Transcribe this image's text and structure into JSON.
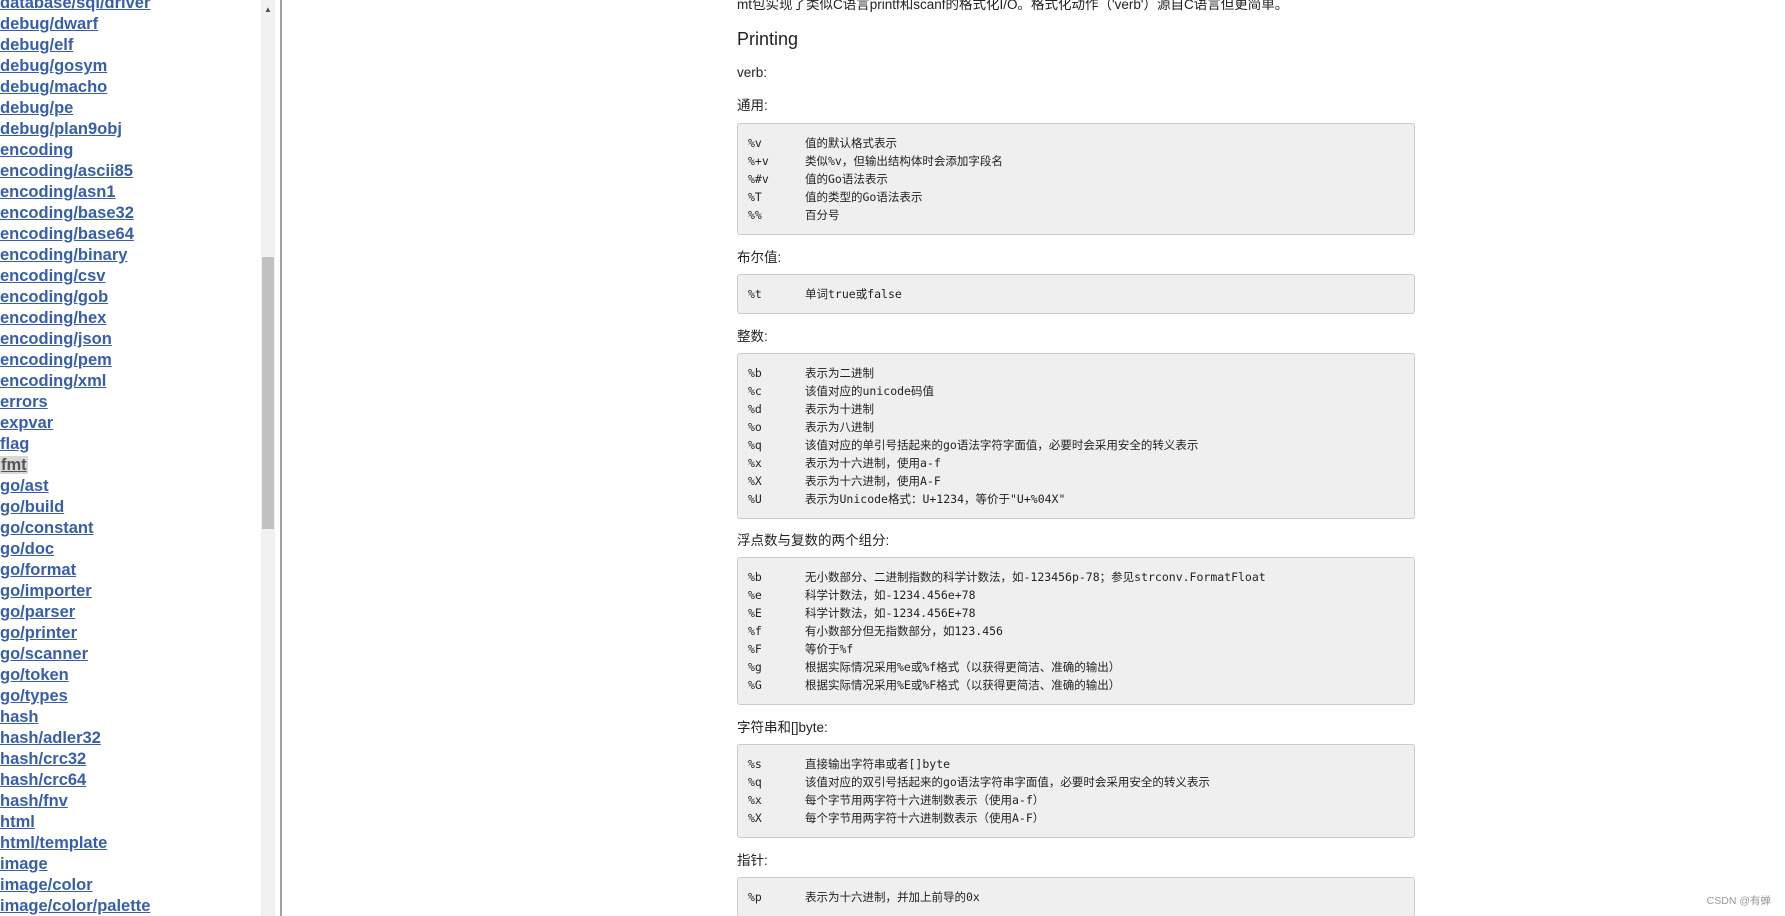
{
  "sidebar": {
    "packages": [
      "database/sql/driver",
      "debug/dwarf",
      "debug/elf",
      "debug/gosym",
      "debug/macho",
      "debug/pe",
      "debug/plan9obj",
      "encoding",
      "encoding/ascii85",
      "encoding/asn1",
      "encoding/base32",
      "encoding/base64",
      "encoding/binary",
      "encoding/csv",
      "encoding/gob",
      "encoding/hex",
      "encoding/json",
      "encoding/pem",
      "encoding/xml",
      "errors",
      "expvar",
      "flag",
      "fmt",
      "go/ast",
      "go/build",
      "go/constant",
      "go/doc",
      "go/format",
      "go/importer",
      "go/parser",
      "go/printer",
      "go/scanner",
      "go/token",
      "go/types",
      "hash",
      "hash/adler32",
      "hash/crc32",
      "hash/crc64",
      "hash/fnv",
      "html",
      "html/template",
      "image",
      "image/color",
      "image/color/palette"
    ],
    "current": "fmt",
    "scroll_up_icon": "▲"
  },
  "content": {
    "intro": "mt包实现了类似C语言printf和scanf的格式化I/O。格式化动作（'verb'）源自C语言但更简单。",
    "heading": "Printing",
    "verb_label": "verb:",
    "sections": [
      {
        "label": "通用:",
        "rows": [
          [
            "%v",
            "值的默认格式表示"
          ],
          [
            "%+v",
            "类似%v，但输出结构体时会添加字段名"
          ],
          [
            "%#v",
            "值的Go语法表示"
          ],
          [
            "%T",
            "值的类型的Go语法表示"
          ],
          [
            "%%",
            "百分号"
          ]
        ]
      },
      {
        "label": "布尔值:",
        "rows": [
          [
            "%t",
            "单词true或false"
          ]
        ]
      },
      {
        "label": "整数:",
        "rows": [
          [
            "%b",
            "表示为二进制"
          ],
          [
            "%c",
            "该值对应的unicode码值"
          ],
          [
            "%d",
            "表示为十进制"
          ],
          [
            "%o",
            "表示为八进制"
          ],
          [
            "%q",
            "该值对应的单引号括起来的go语法字符字面值，必要时会采用安全的转义表示"
          ],
          [
            "%x",
            "表示为十六进制，使用a-f"
          ],
          [
            "%X",
            "表示为十六进制，使用A-F"
          ],
          [
            "%U",
            "表示为Unicode格式：U+1234，等价于\"U+%04X\""
          ]
        ]
      },
      {
        "label": "浮点数与复数的两个组分:",
        "rows": [
          [
            "%b",
            "无小数部分、二进制指数的科学计数法，如-123456p-78；参见strconv.FormatFloat"
          ],
          [
            "%e",
            "科学计数法，如-1234.456e+78"
          ],
          [
            "%E",
            "科学计数法，如-1234.456E+78"
          ],
          [
            "%f",
            "有小数部分但无指数部分，如123.456"
          ],
          [
            "%F",
            "等价于%f"
          ],
          [
            "%g",
            "根据实际情况采用%e或%f格式（以获得更简洁、准确的输出）"
          ],
          [
            "%G",
            "根据实际情况采用%E或%F格式（以获得更简洁、准确的输出）"
          ]
        ]
      },
      {
        "label": "字符串和[]byte:",
        "rows": [
          [
            "%s",
            "直接输出字符串或者[]byte"
          ],
          [
            "%q",
            "该值对应的双引号括起来的go语法字符串字面值，必要时会采用安全的转义表示"
          ],
          [
            "%x",
            "每个字节用两字符十六进制数表示（使用a-f）"
          ],
          [
            "%X",
            "每个字节用两字符十六进制数表示（使用A-F）"
          ]
        ]
      },
      {
        "label": "指针:",
        "rows": [
          [
            "%p",
            "表示为十六进制，并加上前导的0x"
          ]
        ]
      }
    ]
  },
  "footer": "CSDN @有蝉"
}
